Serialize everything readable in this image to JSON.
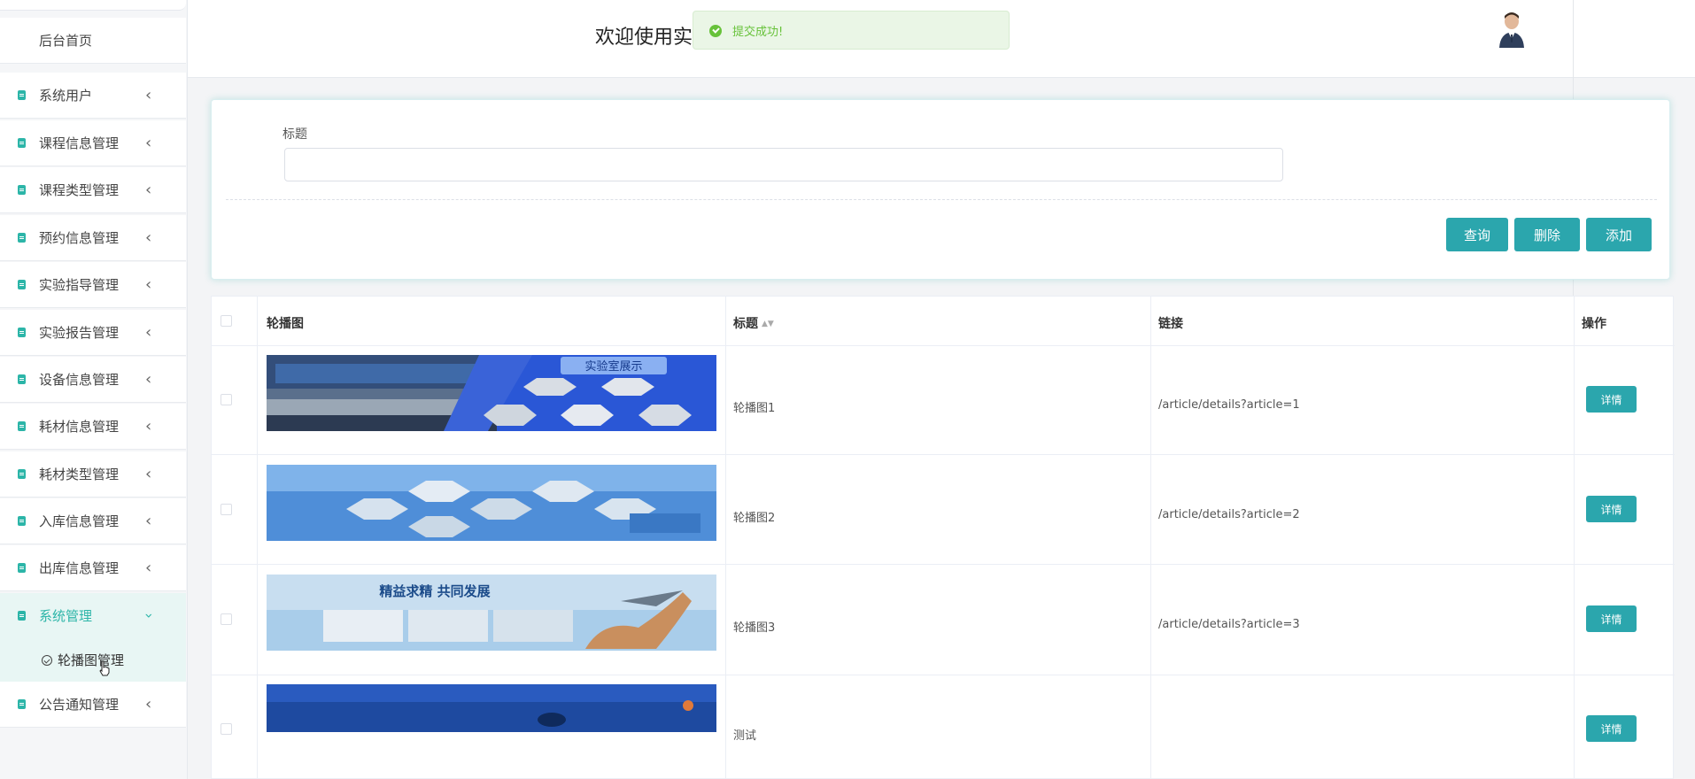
{
  "sidebar": {
    "home": "后台首页",
    "items": [
      {
        "label": "系统用户"
      },
      {
        "label": "课程信息管理"
      },
      {
        "label": "课程类型管理"
      },
      {
        "label": "预约信息管理"
      },
      {
        "label": "实验指导管理"
      },
      {
        "label": "实验报告管理"
      },
      {
        "label": "设备信息管理"
      },
      {
        "label": "耗材信息管理"
      },
      {
        "label": "耗材类型管理"
      },
      {
        "label": "入库信息管理"
      },
      {
        "label": "出库信息管理"
      },
      {
        "label": "系统管理"
      },
      {
        "label": "公告通知管理"
      }
    ],
    "sub_item": "轮播图管理"
  },
  "header": {
    "title": "欢迎使用实"
  },
  "toast": {
    "message": "提交成功!"
  },
  "search": {
    "label": "标题",
    "value": "",
    "buttons": {
      "search": "查询",
      "delete": "删除",
      "add": "添加"
    }
  },
  "table": {
    "headers": {
      "image": "轮播图",
      "title": "标题",
      "link": "链接",
      "action": "操作"
    },
    "rows": [
      {
        "title": "轮播图1",
        "link": "/article/details?article=1",
        "action": "详情",
        "banner_text": "实验室展示"
      },
      {
        "title": "轮播图2",
        "link": "/article/details?article=2",
        "action": "详情",
        "banner_text": ""
      },
      {
        "title": "轮播图3",
        "link": "/article/details?article=3",
        "action": "详情",
        "banner_text": "精益求精 共同发展"
      },
      {
        "title": "测试",
        "link": "",
        "action": "详情",
        "banner_text": ""
      }
    ]
  },
  "colors": {
    "accent": "#2ba6ad",
    "success": "#67c23a",
    "sidebar_icon": "#2cb5a8"
  }
}
